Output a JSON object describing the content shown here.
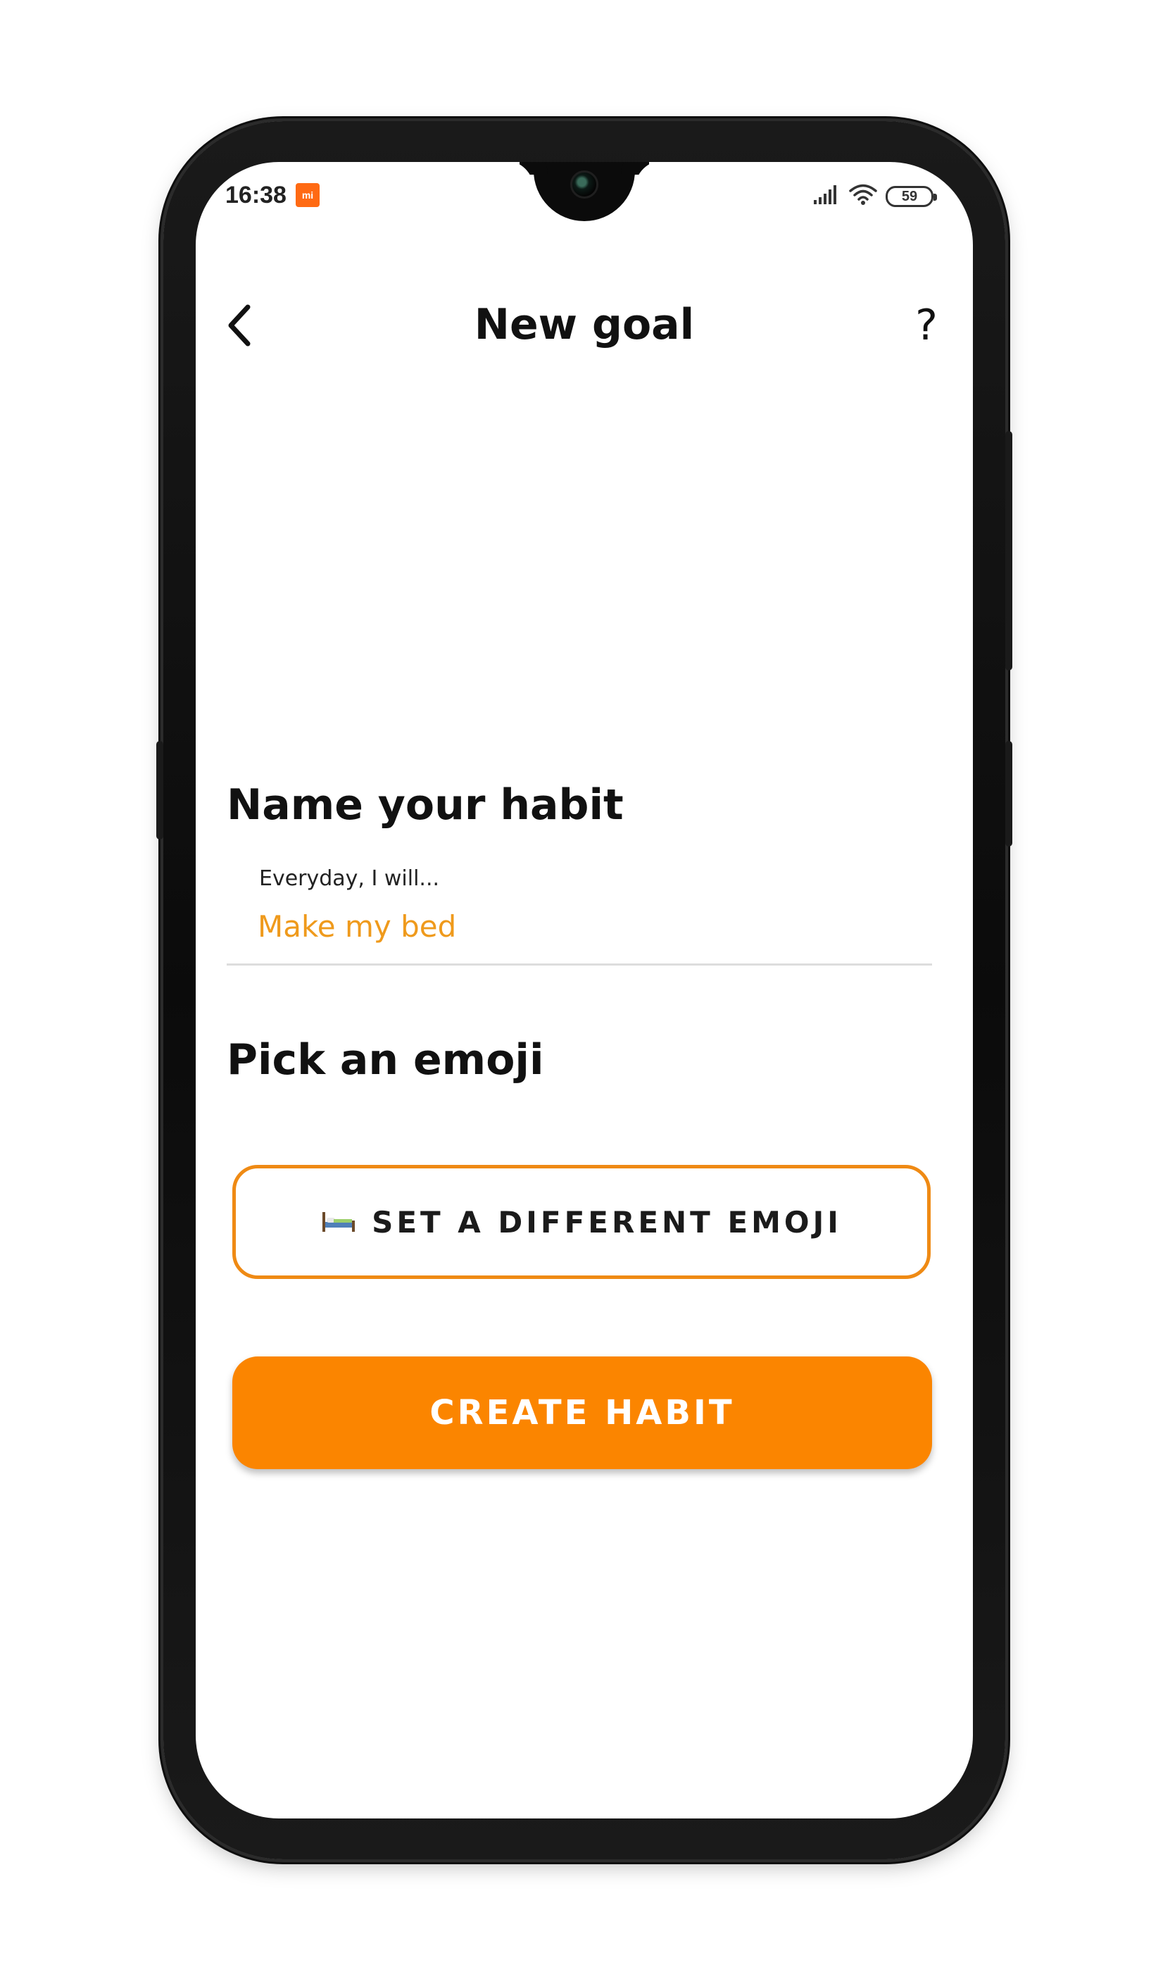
{
  "status_bar": {
    "time": "16:38",
    "notification_icon": "mi-app-icon",
    "notification_text": "mi",
    "signal_icon": "signal-bars-icon",
    "wifi_icon": "wifi-icon",
    "battery_level": "59"
  },
  "header": {
    "back_icon": "chevron-left-icon",
    "title": "New goal",
    "help_label": "?"
  },
  "form": {
    "name_section": {
      "title": "Name your habit",
      "field_label": "Everyday, I will...",
      "field_value": "Make my bed"
    },
    "emoji_section": {
      "title": "Pick an emoji",
      "emoji_icon": "bed-icon",
      "button_label": "SET A DIFFERENT EMOJI"
    },
    "submit_label": "CREATE HABIT"
  },
  "colors": {
    "accent": "#fb8500",
    "accent_border": "#ef8a14",
    "input_text": "#ef9a1c",
    "text_primary": "#111111",
    "divider": "#dddddd"
  }
}
